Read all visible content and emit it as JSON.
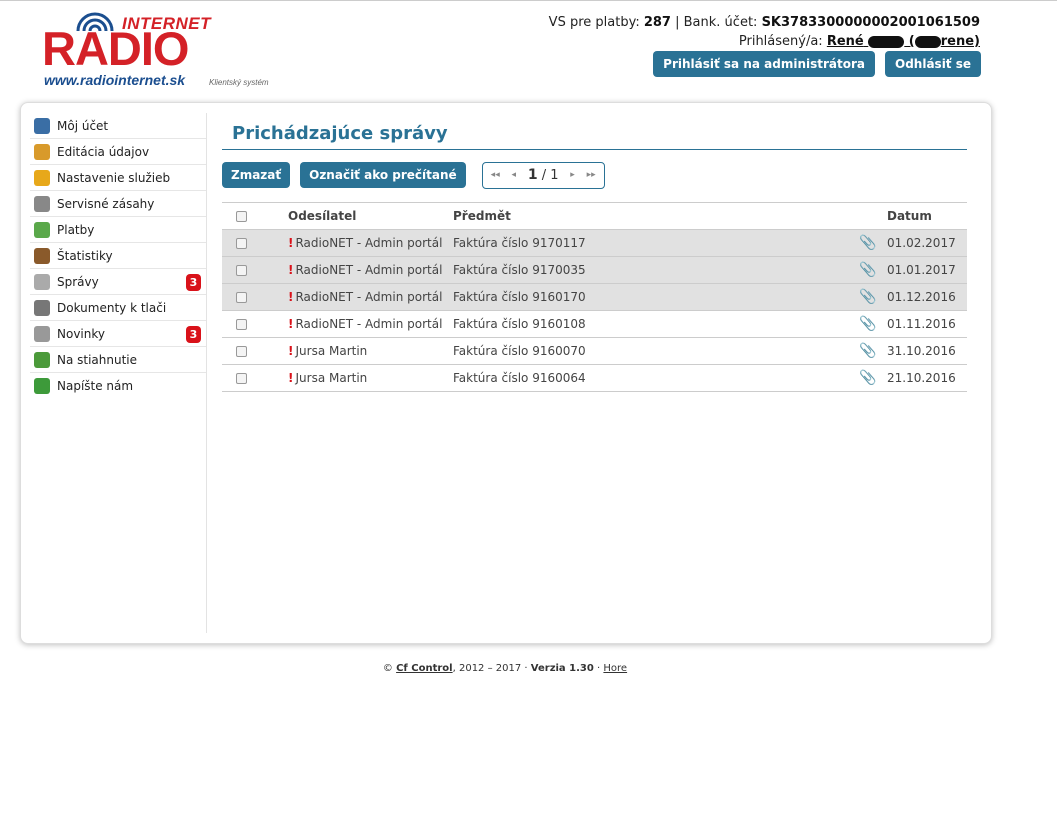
{
  "brand": {
    "logo_top": "INTERNET",
    "logo_main": "RADIO",
    "logo_url": "www.radiointernet.sk",
    "logo_sub": "Klientský systém"
  },
  "header": {
    "vs_label": "VS pre platby:",
    "vs_value": "287",
    "bank_label": "| Bank. účet:",
    "bank_value": "SK3783300000002001061509",
    "logged_label": "Prihlásený/a:",
    "user_first": "René",
    "user_suffix": "rene)",
    "admin_button": "Prihlásiť sa na administrátora",
    "logout_button": "Odhlásiť se"
  },
  "sidebar": {
    "items": [
      {
        "label": "Môj účet",
        "icon": "user-icon",
        "color": "#3a6ea5"
      },
      {
        "label": "Editácia údajov",
        "icon": "user-edit-icon",
        "color": "#d89a2b"
      },
      {
        "label": "Nastavenie služieb",
        "icon": "gear-icon",
        "color": "#e7a81a"
      },
      {
        "label": "Servisné zásahy",
        "icon": "tools-icon",
        "color": "#888888"
      },
      {
        "label": "Platby",
        "icon": "money-icon",
        "color": "#5aa84a"
      },
      {
        "label": "Štatistiky",
        "icon": "chart-icon",
        "color": "#8a5a2b"
      },
      {
        "label": "Správy",
        "icon": "envelope-icon",
        "color": "#aaaaaa",
        "badge": "3"
      },
      {
        "label": "Dokumenty k tlači",
        "icon": "printer-icon",
        "color": "#777777"
      },
      {
        "label": "Novinky",
        "icon": "newspaper-icon",
        "color": "#999999",
        "badge": "3"
      },
      {
        "label": "Na stiahnutie",
        "icon": "download-icon",
        "color": "#4b9a3a"
      },
      {
        "label": "Napíšte nám",
        "icon": "mail-add-icon",
        "color": "#3d9a3a"
      }
    ]
  },
  "main": {
    "title": "Prichádzajúce správy",
    "delete_button": "Zmazať",
    "mark_read_button": "Označiť ako prečítané",
    "pager": {
      "current": "1",
      "total": "/ 1"
    },
    "columns": {
      "sender": "Odesílatel",
      "subject": "Předmět",
      "date": "Datum"
    },
    "rows": [
      {
        "sender": "RadioNET - Admin portál",
        "subject": "Faktúra číslo 9170117",
        "date": "01.02.2017",
        "unread": true
      },
      {
        "sender": "RadioNET - Admin portál",
        "subject": "Faktúra číslo 9170035",
        "date": "01.01.2017",
        "unread": true
      },
      {
        "sender": "RadioNET - Admin portál",
        "subject": "Faktúra číslo 9160170",
        "date": "01.12.2016",
        "unread": true
      },
      {
        "sender": "RadioNET - Admin portál",
        "subject": "Faktúra číslo 9160108",
        "date": "01.11.2016",
        "unread": false
      },
      {
        "sender": "Jursa Martin",
        "subject": "Faktúra číslo 9160070",
        "date": "31.10.2016",
        "unread": false
      },
      {
        "sender": "Jursa Martin",
        "subject": "Faktúra číslo 9160064",
        "date": "21.10.2016",
        "unread": false
      }
    ]
  },
  "footer": {
    "copy": "©",
    "company": "Cf Control",
    "years": ", 2012 – 2017 ·",
    "version": "Verzia 1.30",
    "sep": "·",
    "top_link": "Hore"
  }
}
